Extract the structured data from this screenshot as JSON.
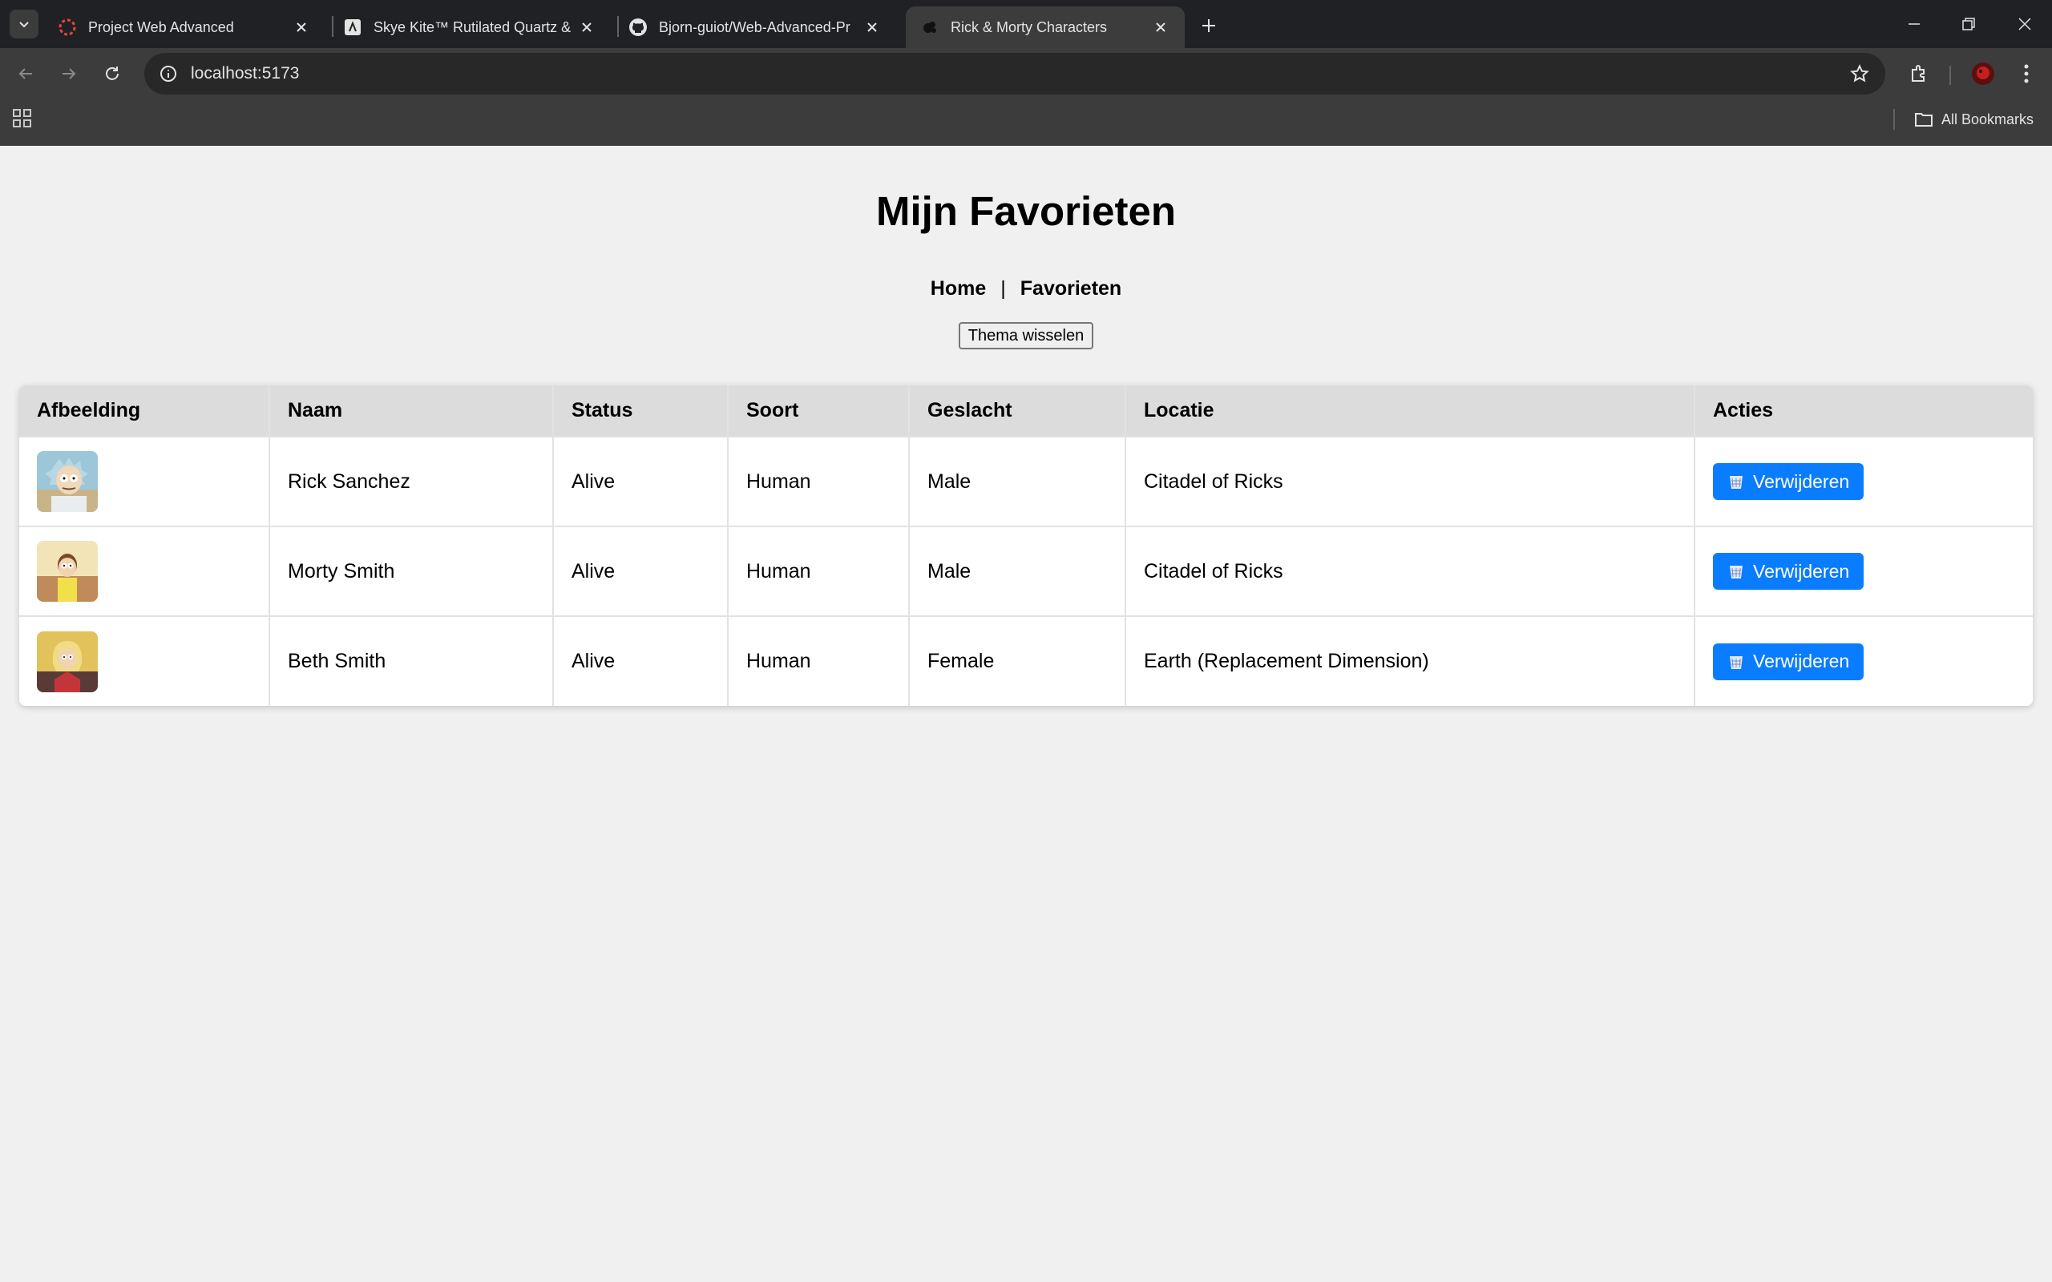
{
  "browser": {
    "tabs": [
      {
        "title": "Project Web Advanced",
        "active": false
      },
      {
        "title": "Skye Kite™ Rutilated Quartz & I",
        "active": false
      },
      {
        "title": "Bjorn-guiot/Web-Advanced-Pr",
        "active": false
      },
      {
        "title": "Rick & Morty Characters",
        "active": true
      }
    ],
    "url": "localhost:5173",
    "bookmarks_label": "All Bookmarks"
  },
  "page": {
    "title": "Mijn Favorieten",
    "nav": {
      "home": "Home",
      "separator": "|",
      "favorites": "Favorieten"
    },
    "theme_button": "Thema wisselen"
  },
  "table": {
    "headers": {
      "image": "Afbeelding",
      "name": "Naam",
      "status": "Status",
      "species": "Soort",
      "gender": "Geslacht",
      "location": "Locatie",
      "actions": "Acties"
    },
    "rows": [
      {
        "name": "Rick Sanchez",
        "status": "Alive",
        "species": "Human",
        "gender": "Male",
        "location": "Citadel of Ricks",
        "action": "Verwijderen"
      },
      {
        "name": "Morty Smith",
        "status": "Alive",
        "species": "Human",
        "gender": "Male",
        "location": "Citadel of Ricks",
        "action": "Verwijderen"
      },
      {
        "name": "Beth Smith",
        "status": "Alive",
        "species": "Human",
        "gender": "Female",
        "location": "Earth (Replacement Dimension)",
        "action": "Verwijderen"
      }
    ]
  },
  "colors": {
    "accent_button": "#0a7cff",
    "header_bg": "#dcdcdc",
    "page_bg": "#f0f0f0"
  }
}
